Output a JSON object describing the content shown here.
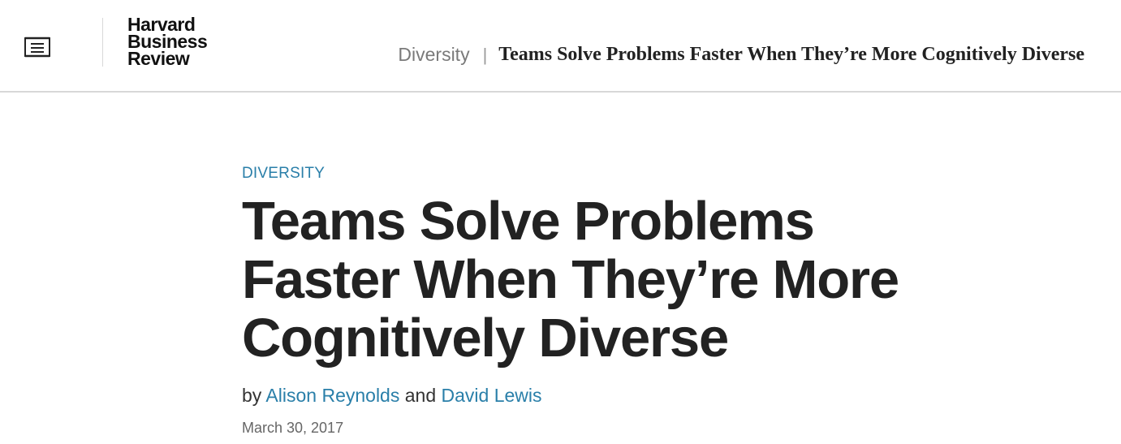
{
  "header": {
    "menu_icon": "menu-list-icon",
    "logo": {
      "line1": "Harvard",
      "line2": "Business",
      "line3": "Review"
    },
    "breadcrumb": {
      "topic": "Diversity",
      "separator": "|",
      "title": "Teams Solve Problems Faster When They’re More Cognitively Diverse"
    }
  },
  "article": {
    "topic_tag": "DIVERSITY",
    "headline": "Teams Solve Problems Faster When They’re More Cognitively Diverse",
    "byline": {
      "prefix": "by",
      "author1": "Alison Reynolds",
      "conjunction": "and",
      "author2": "David Lewis"
    },
    "date": "March 30, 2017"
  },
  "colors": {
    "link_blue": "#2a7fa9",
    "text_dark": "#222222",
    "muted_gray": "#7a7a7a",
    "divider": "#d8d8d8"
  }
}
